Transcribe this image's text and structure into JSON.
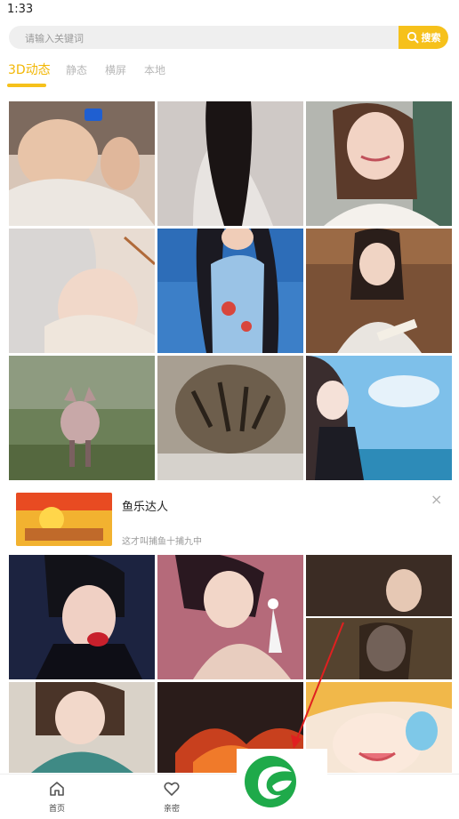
{
  "status": {
    "time": "1:33"
  },
  "search": {
    "placeholder": "请输入关键词",
    "button_label": "搜索"
  },
  "tabs": [
    {
      "label": "3D动态",
      "active": true
    },
    {
      "label": "静态",
      "active": false
    },
    {
      "label": "横屏",
      "active": false
    },
    {
      "label": "本地",
      "active": false
    }
  ],
  "grid_top": [
    {
      "name": "wallpaper-woman-drinking"
    },
    {
      "name": "wallpaper-long-hair-back"
    },
    {
      "name": "wallpaper-smiling-girl"
    },
    {
      "name": "wallpaper-anime-girl-silver"
    },
    {
      "name": "wallpaper-qipao-girl"
    },
    {
      "name": "wallpaper-girl-fan"
    },
    {
      "name": "wallpaper-fox"
    },
    {
      "name": "wallpaper-tiger"
    },
    {
      "name": "wallpaper-anime-girl-sea"
    }
  ],
  "ad": {
    "title": "鱼乐达人",
    "subtitle": "这才叫捕鱼十捕九中",
    "close_label": "×"
  },
  "grid_bottom": [
    {
      "name": "wallpaper-boy-microphone"
    },
    {
      "name": "wallpaper-woman-earrings"
    },
    {
      "name": "wallpaper-drama-collage"
    },
    {
      "name": "wallpaper-girl-scarf"
    },
    {
      "name": "wallpaper-fire-leaves"
    },
    {
      "name": "wallpaper-anime-face"
    }
  ],
  "bottom_nav": [
    {
      "label": "首页",
      "icon": "home-icon"
    },
    {
      "label": "亲密",
      "icon": "heart-icon"
    }
  ],
  "colors": {
    "accent": "#f6c11b",
    "tab_active": "#f2b705",
    "logo_green": "#1faa4a",
    "arrow_red": "#e02020"
  }
}
